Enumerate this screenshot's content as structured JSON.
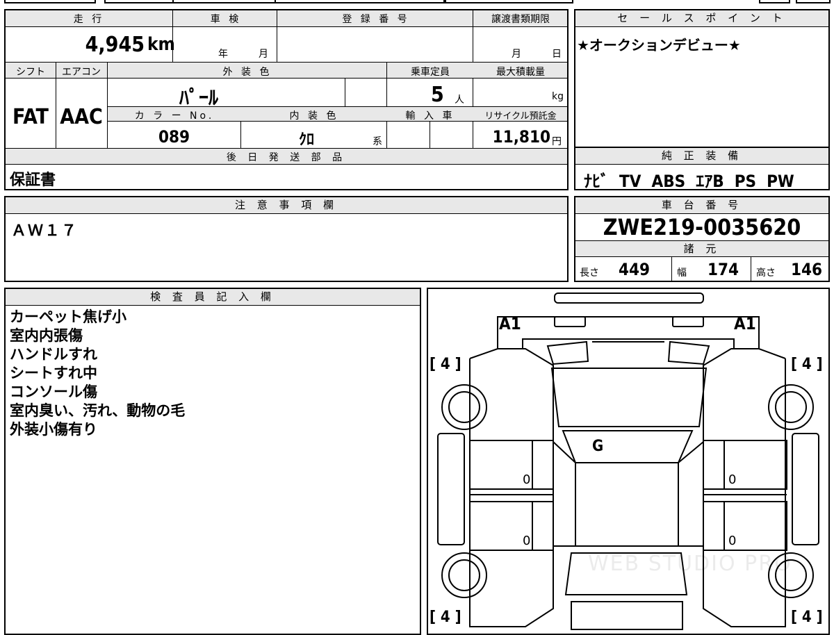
{
  "top_strip": {
    "text": "",
    "partial": "国 内 外"
  },
  "vehicle": {
    "mileage_label": "走 行",
    "mileage": "4,945",
    "mileage_unit": "km",
    "shaken_label": "車 検",
    "shaken_year": "年",
    "shaken_month": "月",
    "reg_label": "登 録 番 号",
    "transfer_label": "譲渡書類期限",
    "transfer_month": "月",
    "transfer_day": "日",
    "shift_label": "シフト",
    "shift": "FAT",
    "ac_label": "エアコン",
    "ac": "AAC",
    "ext_color_label": "外 装 色",
    "ext_color": "ﾊﾟｰﾙ",
    "capacity_label": "乗車定員",
    "capacity": "5",
    "capacity_unit": "人",
    "max_load_label": "最大積載量",
    "max_load_unit": "kg",
    "color_no_label": "カ ラ ー No.",
    "color_no": "089",
    "int_color_label": "内 装 色",
    "int_color": "ｸﾛ",
    "int_color_suffix": "系",
    "import_label": "輸 入 車",
    "recycle_label": "リサイクル預託金",
    "recycle_fee": "11,810",
    "recycle_unit": "円",
    "later_parts_label": "後 日 発 送 部 品",
    "later_parts": "保証書"
  },
  "sales_point": {
    "label": "セ ー ル ス ポ イ ン ト",
    "text": "★オークションデビュー★"
  },
  "equipment": {
    "label": "純 正 装 備",
    "text": "ﾅﾋﾞ  TV  ABS  ｴｱB  PS  PW"
  },
  "notes": {
    "label": "注 意 事 項 欄",
    "text": "ＡＷ１７"
  },
  "chassis": {
    "label": "車 台 番 号",
    "number": "ZWE219-0035620",
    "specs_label": "諸 元",
    "length_label": "長さ",
    "length": "449",
    "width_label": "幅",
    "width": "174",
    "height_label": "高さ",
    "height": "146"
  },
  "inspector": {
    "label": "検 査 員 記 入 欄",
    "lines": [
      "カーペット焦げ小",
      "室内内張傷",
      "ハンドルすれ",
      "シートすれ中",
      "コンソール傷",
      "室内臭い、汚れ、動物の毛",
      "外装小傷有り"
    ]
  },
  "diagram": {
    "a1_left": "A1",
    "a1_right": "A1",
    "tire_fl": "[ 4 ]",
    "tire_fr": "[ 4 ]",
    "tire_rl": "[ 4 ]",
    "tire_rr": "[ 4 ]",
    "windshield": "G",
    "door_fl": "0",
    "door_fr": "0",
    "door_rl": "0",
    "door_rr": "0",
    "watermark": "WEB STUDIO PRO"
  }
}
